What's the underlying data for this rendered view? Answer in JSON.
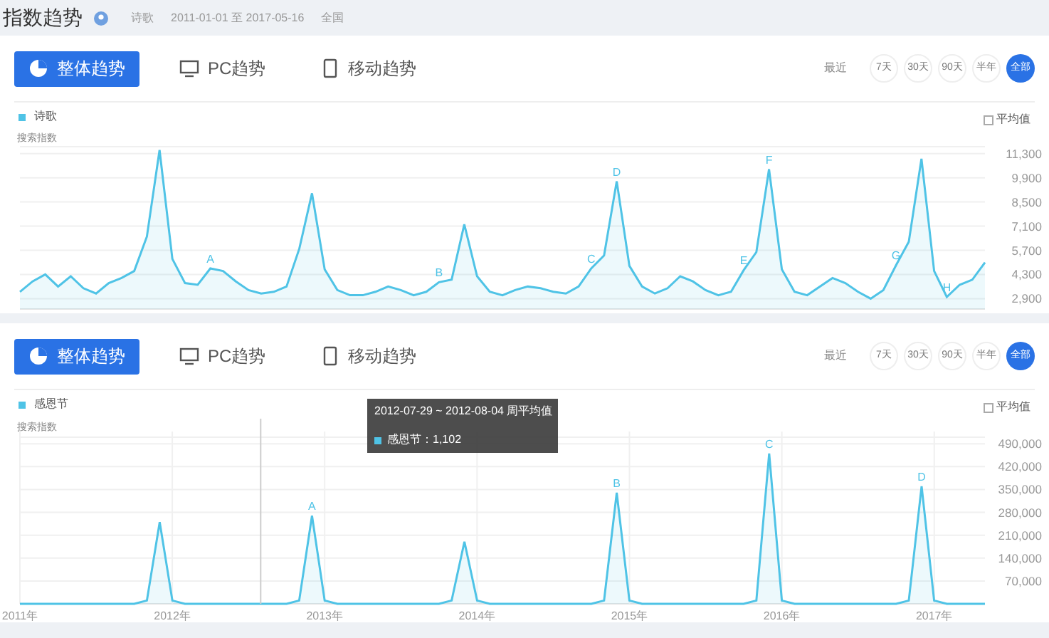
{
  "header": {
    "title": "指数趋势",
    "keyword": "诗歌",
    "date_range": "2011-01-01 至 2017-05-16",
    "region": "全国"
  },
  "panels": [
    {
      "tabs": [
        {
          "label": "整体趋势",
          "kind": "overall",
          "selected": true
        },
        {
          "label": "PC趋势",
          "kind": "pc",
          "selected": false
        },
        {
          "label": "移动趋势",
          "kind": "mobile",
          "selected": false
        }
      ],
      "recent_label": "最近",
      "ranges": [
        {
          "label": "7天",
          "selected": false
        },
        {
          "label": "30天",
          "selected": false
        },
        {
          "label": "90天",
          "selected": false
        },
        {
          "label": "半年",
          "selected": false
        },
        {
          "label": "全部",
          "selected": true
        }
      ],
      "average": {
        "label": "平均值",
        "checked": false
      },
      "chart_data": {
        "type": "area",
        "ylabel": "搜索指数",
        "grid": true,
        "ylim": [
          2300,
          11700
        ],
        "yticks": [
          {
            "value": 2900,
            "label": "2,900"
          },
          {
            "value": 4300,
            "label": "4,300"
          },
          {
            "value": 5700,
            "label": "5,700"
          },
          {
            "value": 7100,
            "label": "7,100"
          },
          {
            "value": 8500,
            "label": "8,500"
          },
          {
            "value": 9900,
            "label": "9,900"
          },
          {
            "value": 11300,
            "label": "11,300"
          }
        ],
        "series": [
          {
            "name": "诗歌",
            "color": "#4fc3e6",
            "values": [
              3300,
              3900,
              4300,
              3600,
              4200,
              3500,
              3200,
              3800,
              4100,
              4500,
              6500,
              11500,
              5200,
              3800,
              3700,
              4650,
              4500,
              3900,
              3400,
              3200,
              3300,
              3600,
              5800,
              9000,
              4600,
              3400,
              3100,
              3100,
              3300,
              3600,
              3400,
              3100,
              3300,
              3850,
              4000,
              7200,
              4200,
              3300,
              3100,
              3400,
              3600,
              3500,
              3300,
              3200,
              3600,
              4650,
              5400,
              9700,
              4800,
              3600,
              3200,
              3500,
              4200,
              3900,
              3400,
              3100,
              3300,
              4550,
              5600,
              10400,
              4600,
              3300,
              3100,
              3600,
              4100,
              3800,
              3300,
              2900,
              3400,
              4850,
              6200,
              11000,
              4500,
              3000,
              3700,
              4000,
              5000
            ]
          }
        ],
        "annotations": [
          {
            "y": 4650,
            "text": "A"
          },
          {
            "y": 3850,
            "text": "B"
          },
          {
            "y": 4650,
            "text": "C"
          },
          {
            "y": 9700,
            "text": "D"
          },
          {
            "y": 4550,
            "text": "E"
          },
          {
            "y": 10400,
            "text": "F"
          },
          {
            "y": 4850,
            "text": "G"
          },
          {
            "y": 3000,
            "text": "H"
          }
        ]
      }
    },
    {
      "tabs": [
        {
          "label": "整体趋势",
          "kind": "overall",
          "selected": true
        },
        {
          "label": "PC趋势",
          "kind": "pc",
          "selected": false
        },
        {
          "label": "移动趋势",
          "kind": "mobile",
          "selected": false
        }
      ],
      "recent_label": "最近",
      "ranges": [
        {
          "label": "7天",
          "selected": false
        },
        {
          "label": "30天",
          "selected": false
        },
        {
          "label": "90天",
          "selected": false
        },
        {
          "label": "半年",
          "selected": false
        },
        {
          "label": "全部",
          "selected": true
        }
      ],
      "average": {
        "label": "平均值",
        "checked": false
      },
      "tooltip": {
        "title": "2012-07-29 ~ 2012-08-04 周平均值",
        "line": "感恩节：1,102"
      },
      "chart_data": {
        "type": "area",
        "ylabel": "搜索指数",
        "grid": true,
        "ylim": [
          0,
          510000
        ],
        "xlim": [
          2011,
          2017.333
        ],
        "yticks": [
          {
            "value": 70000,
            "label": "70,000"
          },
          {
            "value": 140000,
            "label": "140,000"
          },
          {
            "value": 210000,
            "label": "210,000"
          },
          {
            "value": 280000,
            "label": "280,000"
          },
          {
            "value": 350000,
            "label": "350,000"
          },
          {
            "value": 420000,
            "label": "420,000"
          },
          {
            "value": 490000,
            "label": "490,000"
          }
        ],
        "x": [
          2011,
          2011.083,
          2011.167,
          2011.25,
          2011.333,
          2011.417,
          2011.5,
          2011.583,
          2011.667,
          2011.75,
          2011.833,
          2011.917,
          2012,
          2012.083,
          2012.167,
          2012.25,
          2012.333,
          2012.417,
          2012.5,
          2012.583,
          2012.667,
          2012.75,
          2012.833,
          2012.917,
          2013,
          2013.083,
          2013.167,
          2013.25,
          2013.333,
          2013.417,
          2013.5,
          2013.583,
          2013.667,
          2013.75,
          2013.833,
          2013.917,
          2014,
          2014.083,
          2014.167,
          2014.25,
          2014.333,
          2014.417,
          2014.5,
          2014.583,
          2014.667,
          2014.75,
          2014.833,
          2014.917,
          2015,
          2015.083,
          2015.167,
          2015.25,
          2015.333,
          2015.417,
          2015.5,
          2015.583,
          2015.667,
          2015.75,
          2015.833,
          2015.917,
          2016,
          2016.083,
          2016.167,
          2016.25,
          2016.333,
          2016.417,
          2016.5,
          2016.583,
          2016.667,
          2016.75,
          2016.833,
          2016.917,
          2017,
          2017.083,
          2017.167,
          2017.25,
          2017.333
        ],
        "xticks": [
          {
            "value": 2011,
            "label": "2011年"
          },
          {
            "value": 2012,
            "label": "2012年"
          },
          {
            "value": 2013,
            "label": "2013年"
          },
          {
            "value": 2014,
            "label": "2014年"
          },
          {
            "value": 2015,
            "label": "2015年"
          },
          {
            "value": 2016,
            "label": "2016年"
          },
          {
            "value": 2017,
            "label": "2017年"
          }
        ],
        "series": [
          {
            "name": "感恩节",
            "color": "#4fc3e6",
            "values": [
              0,
              0,
              0,
              0,
              0,
              0,
              0,
              0,
              0,
              0,
              10000,
              250000,
              10000,
              0,
              0,
              0,
              0,
              0,
              0,
              0,
              0,
              0,
              10000,
              270000,
              10000,
              0,
              0,
              0,
              0,
              0,
              0,
              0,
              0,
              0,
              10000,
              190000,
              10000,
              0,
              0,
              0,
              0,
              0,
              0,
              0,
              0,
              0,
              10000,
              340000,
              10000,
              0,
              0,
              0,
              0,
              0,
              0,
              0,
              0,
              0,
              10000,
              460000,
              10000,
              0,
              0,
              0,
              0,
              0,
              0,
              0,
              0,
              0,
              10000,
              360000,
              10000,
              0,
              0,
              0,
              0
            ]
          }
        ],
        "ref_lines": [
          {
            "axis": "x",
            "value": 2012.58
          }
        ],
        "annotations": [
          {
            "x": 2012.917,
            "y": 270000,
            "text": "A"
          },
          {
            "x": 2014.917,
            "y": 340000,
            "text": "B"
          },
          {
            "x": 2015.917,
            "y": 460000,
            "text": "C"
          },
          {
            "x": 2016.917,
            "y": 360000,
            "text": "D"
          }
        ]
      }
    }
  ]
}
